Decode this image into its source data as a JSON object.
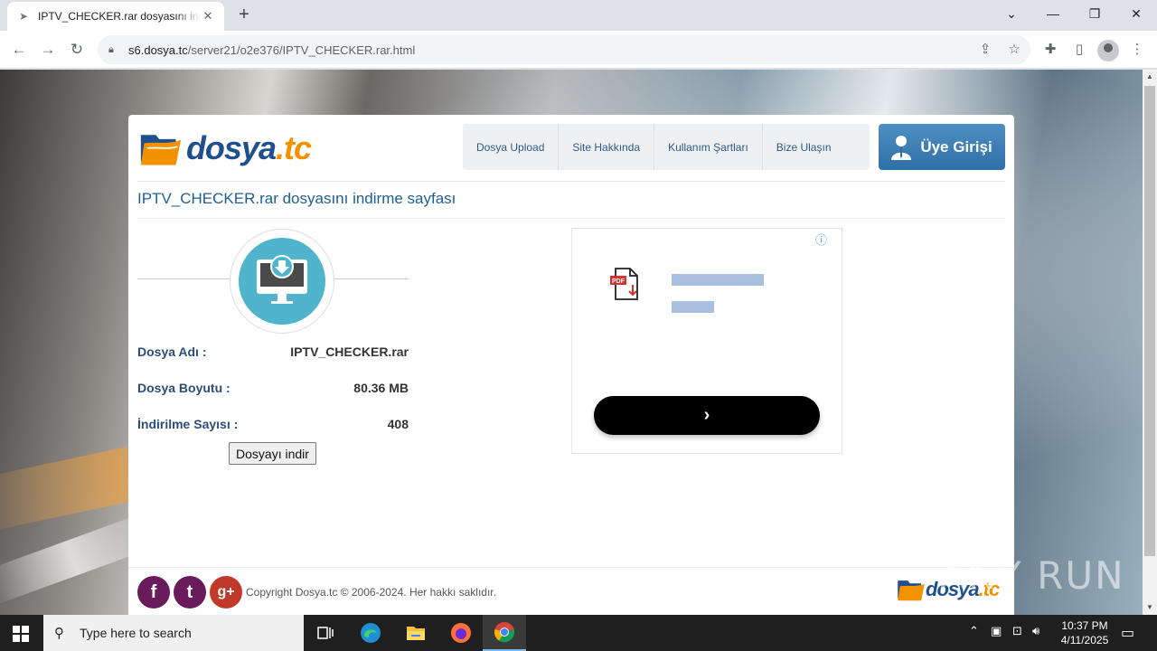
{
  "browser": {
    "tab_title": "IPTV_CHECKER.rar dosyasını indirme sayfası",
    "url_host": "s6.dosya.tc",
    "url_path": "/server21/o2e376/IPTV_CHECKER.rar.html"
  },
  "site": {
    "logo_main": "dosya",
    "logo_tld": ".tc",
    "nav": [
      "Dosya Upload",
      "Site Hakkında",
      "Kullanım Şartları",
      "Bize Ulaşın"
    ],
    "login_label": "Üye Girişi"
  },
  "page": {
    "title": "IPTV_CHECKER.rar dosyasını indirme sayfası",
    "rows": [
      {
        "label": "Dosya Adı :",
        "value": "IPTV_CHECKER.rar"
      },
      {
        "label": "Dosya Boyutu :",
        "value": "80.36 MB"
      },
      {
        "label": "İndirilme Sayısı :",
        "value": "408"
      }
    ],
    "download_button": "Dosyayı indir"
  },
  "ad": {
    "info_icon": "ⓘ",
    "cta_icon": "›"
  },
  "footer": {
    "copyright": "Copyright Dosya.tc © 2006-2024. Her hakkı saklıdır.",
    "social": [
      "f",
      "t",
      "g+"
    ]
  },
  "watermark": "ANY RUN",
  "taskbar": {
    "search_placeholder": "Type here to search",
    "time": "10:37 PM",
    "date": "4/11/2025"
  },
  "colors": {
    "brand_blue": "#1f4f8c",
    "brand_orange": "#f39200",
    "title_blue": "#1f5d95",
    "login_blue": "#2f6fa6",
    "social_purple": "#6a1b5c"
  }
}
